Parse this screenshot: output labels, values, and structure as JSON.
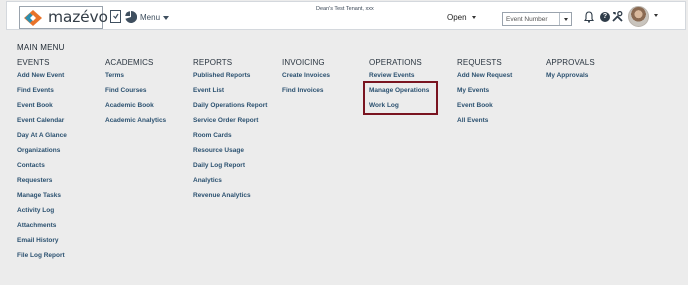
{
  "header": {
    "logo_text": "mazévo",
    "menu_label": "Menu",
    "tenant": "Dean's Test Tenant, xxx",
    "status_value": "Open",
    "search": {
      "placeholder": "Event Number"
    },
    "icons": [
      "bookmark-icon",
      "pie-chart-icon",
      "bell-icon",
      "help-icon",
      "tools-icon",
      "avatar"
    ]
  },
  "main_menu": {
    "title": "MAIN MENU",
    "columns": [
      {
        "heading": "EVENTS",
        "items": [
          "Add New Event",
          "Find Events",
          "Event Book",
          "Event Calendar",
          "Day At A Glance",
          "Organizations",
          "Contacts",
          "Requesters",
          "Manage Tasks",
          "Activity Log",
          "Attachments",
          "Email History",
          "File Log Report"
        ]
      },
      {
        "heading": "ACADEMICS",
        "items": [
          "Terms",
          "Find Courses",
          "Academic Book",
          "Academic Analytics"
        ]
      },
      {
        "heading": "REPORTS",
        "items": [
          "Published Reports",
          "Event List",
          "Daily Operations Report",
          "Service Order Report",
          "Room Cards",
          "Resource Usage",
          "Daily Log Report",
          "Analytics",
          "Revenue Analytics"
        ]
      },
      {
        "heading": "INVOICING",
        "items": [
          "Create Invoices",
          "Find Invoices"
        ]
      },
      {
        "heading": "OPERATIONS",
        "items": [
          "Review Events",
          "Manage Operations",
          "Work Log"
        ]
      },
      {
        "heading": "REQUESTS",
        "items": [
          "Add New Request",
          "My Events",
          "Event Book",
          "All Events"
        ]
      },
      {
        "heading": "APPROVALS",
        "items": [
          "My Approvals"
        ]
      }
    ]
  },
  "colors": {
    "link": "#2b5170",
    "heading": "#2a3540",
    "highlight_border": "#7a1420",
    "logo_orange": "#e8732a",
    "logo_teal": "#2a8fb0",
    "background": "#ececec"
  }
}
